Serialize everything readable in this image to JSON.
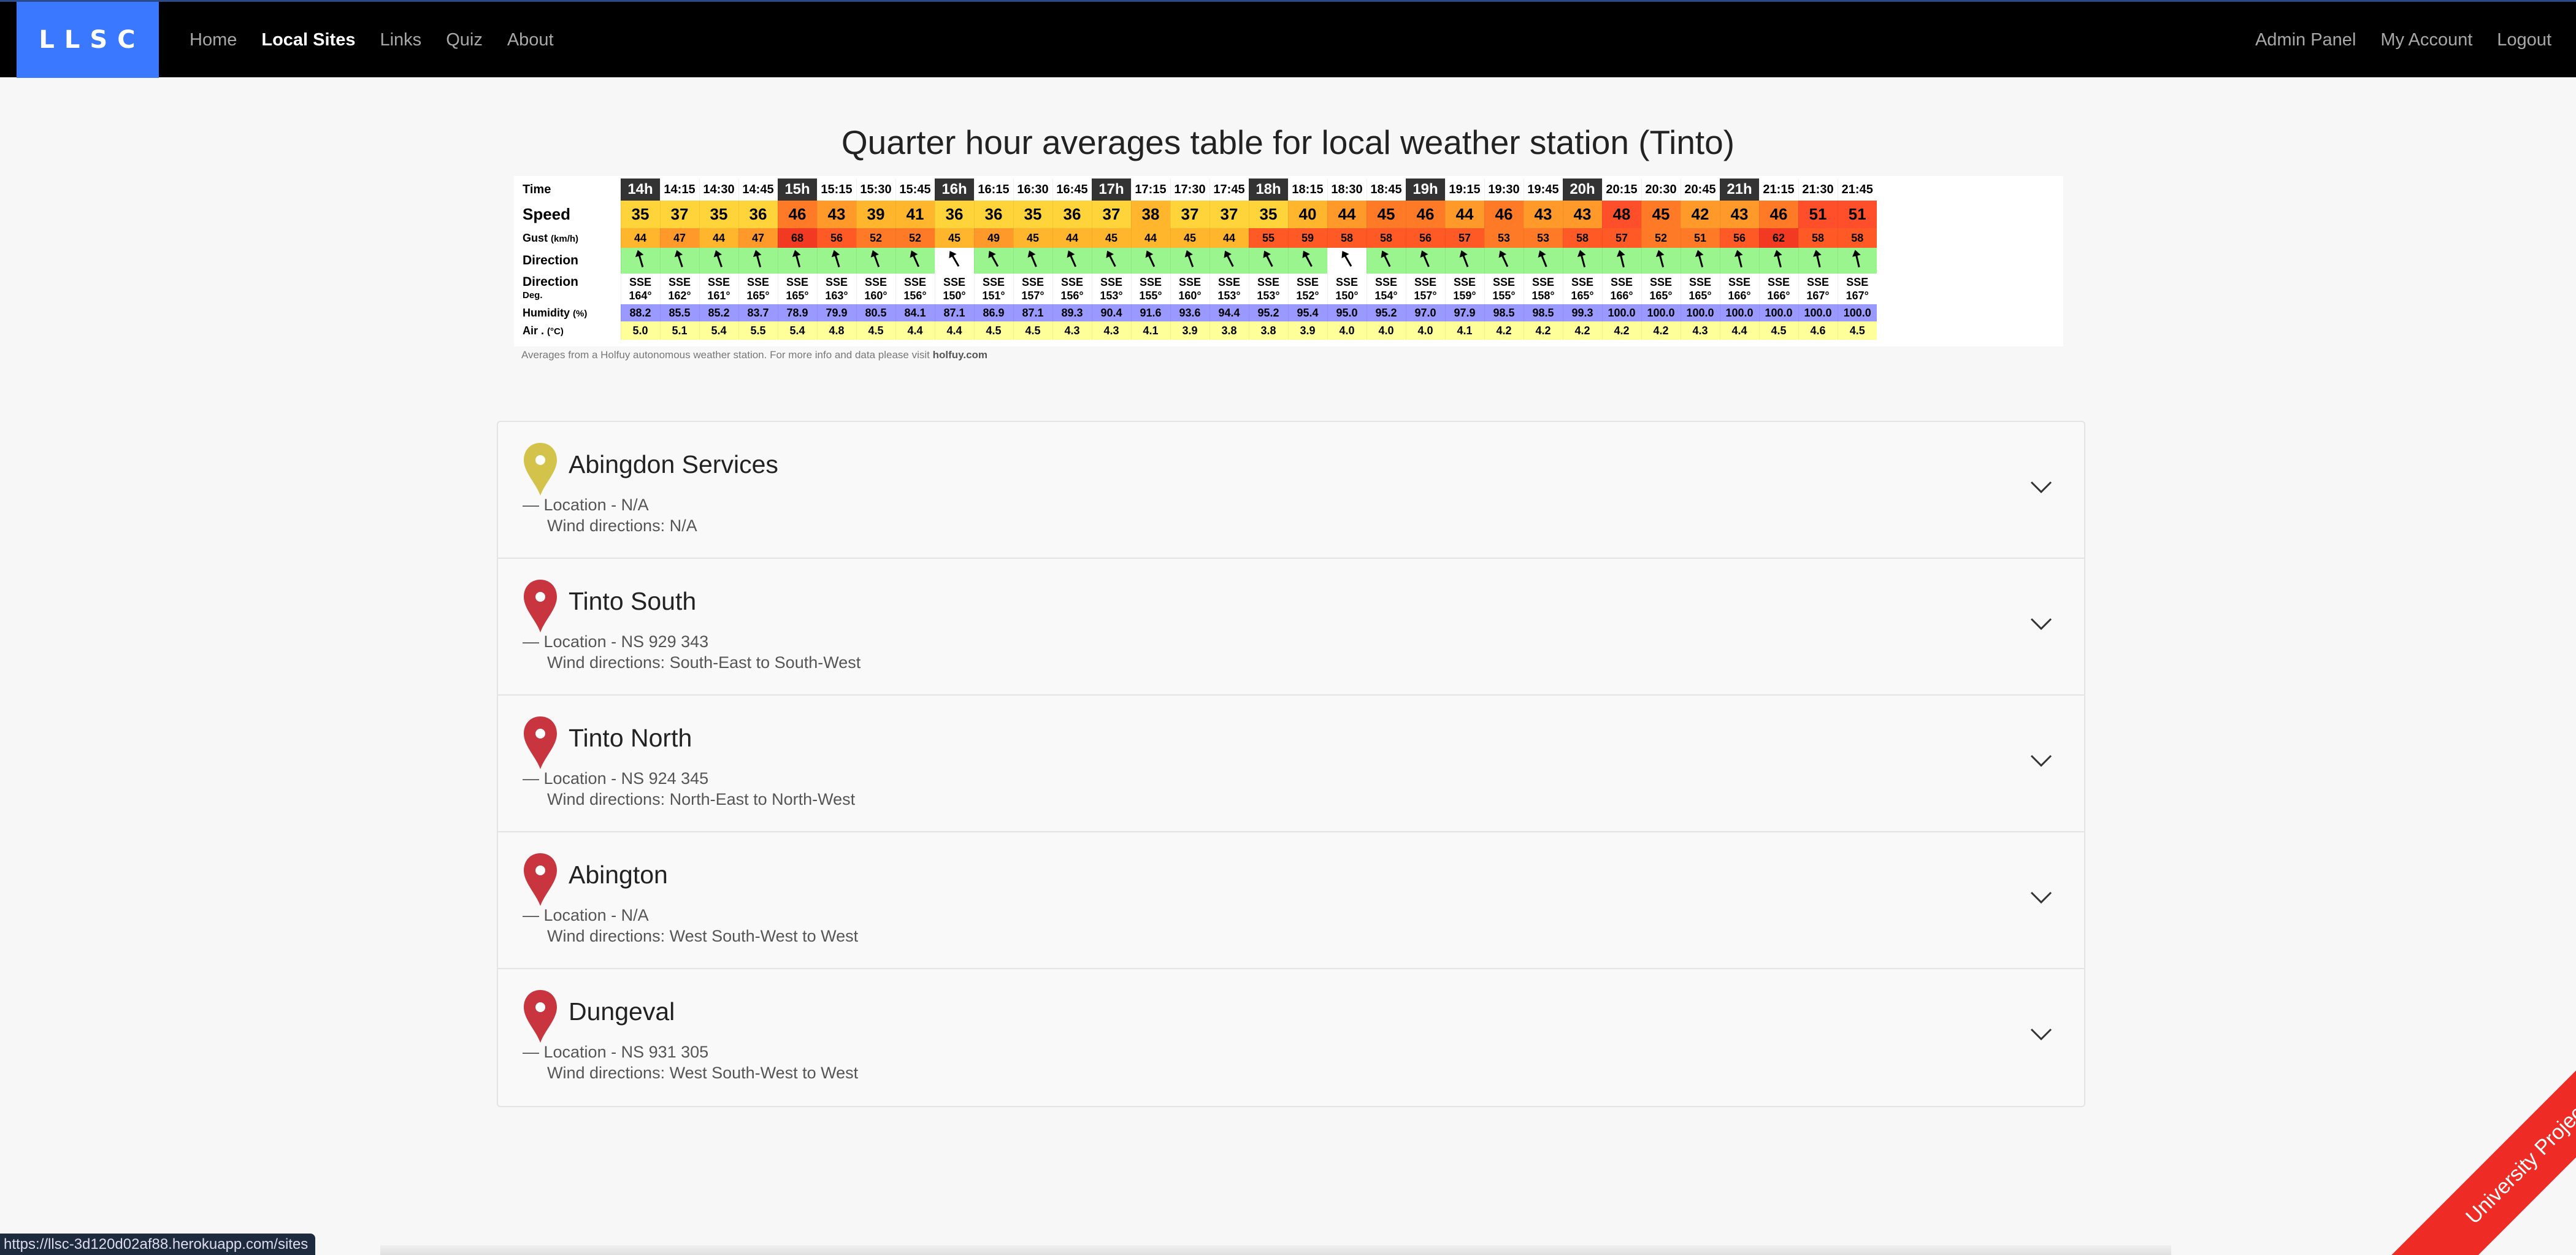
{
  "nav": {
    "brand": "LLSC",
    "left": [
      "Home",
      "Local Sites",
      "Links",
      "Quiz",
      "About"
    ],
    "right": [
      "Admin Panel",
      "My Account",
      "Logout"
    ],
    "active": "Local Sites"
  },
  "title": "Quarter hour averages table for local weather station (Tinto)",
  "weather": {
    "labels": {
      "time": "Time",
      "speed": "Speed",
      "gust": "Gust",
      "gust_unit": "(km/h)",
      "direction": "Direction",
      "direction_deg_1": "Direction",
      "direction_deg_2": "Deg.",
      "humidity": "Humidity",
      "humidity_unit": "(%)",
      "air": "Air .",
      "air_unit": "(°C)"
    },
    "times": [
      "14h",
      "14:15",
      "14:30",
      "14:45",
      "15h",
      "15:15",
      "15:30",
      "15:45",
      "16h",
      "16:15",
      "16:30",
      "16:45",
      "17h",
      "17:15",
      "17:30",
      "17:45",
      "18h",
      "18:15",
      "18:30",
      "18:45",
      "19h",
      "19:15",
      "19:30",
      "19:45",
      "20h",
      "20:15",
      "20:30",
      "20:45",
      "21h",
      "21:15",
      "21:30",
      "21:45"
    ],
    "speed": [
      "35",
      "37",
      "35",
      "36",
      "46",
      "43",
      "39",
      "41",
      "36",
      "36",
      "35",
      "36",
      "37",
      "38",
      "37",
      "37",
      "35",
      "40",
      "44",
      "45",
      "46",
      "44",
      "46",
      "43",
      "43",
      "48",
      "45",
      "42",
      "43",
      "46",
      "51",
      "51"
    ],
    "gust": [
      "44",
      "47",
      "44",
      "47",
      "68",
      "56",
      "52",
      "52",
      "45",
      "49",
      "45",
      "44",
      "45",
      "44",
      "45",
      "44",
      "55",
      "59",
      "58",
      "58",
      "56",
      "57",
      "53",
      "53",
      "58",
      "57",
      "52",
      "51",
      "56",
      "62",
      "58",
      "58"
    ],
    "dir_name": [
      "SSE",
      "SSE",
      "SSE",
      "SSE",
      "SSE",
      "SSE",
      "SSE",
      "SSE",
      "SSE",
      "SSE",
      "SSE",
      "SSE",
      "SSE",
      "SSE",
      "SSE",
      "SSE",
      "SSE",
      "SSE",
      "SSE",
      "SSE",
      "SSE",
      "SSE",
      "SSE",
      "SSE",
      "SSE",
      "SSE",
      "SSE",
      "SSE",
      "SSE",
      "SSE",
      "SSE",
      "SSE"
    ],
    "dir_deg": [
      164,
      162,
      161,
      165,
      165,
      163,
      160,
      156,
      150,
      151,
      157,
      156,
      153,
      155,
      160,
      153,
      153,
      152,
      150,
      154,
      157,
      159,
      155,
      158,
      165,
      166,
      165,
      165,
      166,
      166,
      167,
      167
    ],
    "dir_deg_text": [
      "164°",
      "162°",
      "161°",
      "165°",
      "165°",
      "163°",
      "160°",
      "156°",
      "150°",
      "151°",
      "157°",
      "156°",
      "153°",
      "155°",
      "160°",
      "153°",
      "153°",
      "152°",
      "150°",
      "154°",
      "157°",
      "159°",
      "155°",
      "158°",
      "165°",
      "166°",
      "165°",
      "165°",
      "166°",
      "166°",
      "167°",
      "167°"
    ],
    "humidity": [
      "88.2",
      "85.5",
      "85.2",
      "83.7",
      "78.9",
      "79.9",
      "80.5",
      "84.1",
      "87.1",
      "86.9",
      "87.1",
      "89.3",
      "90.4",
      "91.6",
      "93.6",
      "94.4",
      "95.2",
      "95.4",
      "95.0",
      "95.2",
      "97.0",
      "97.9",
      "98.5",
      "98.5",
      "99.3",
      "100.0",
      "100.0",
      "100.0",
      "100.0",
      "100.0",
      "100.0",
      "100.0"
    ],
    "air": [
      "5.0",
      "5.1",
      "5.4",
      "5.5",
      "5.4",
      "4.8",
      "4.5",
      "4.4",
      "4.4",
      "4.5",
      "4.5",
      "4.3",
      "4.3",
      "4.1",
      "3.9",
      "3.8",
      "3.8",
      "3.9",
      "4.0",
      "4.0",
      "4.0",
      "4.1",
      "4.2",
      "4.2",
      "4.2",
      "4.2",
      "4.2",
      "4.3",
      "4.4",
      "4.5",
      "4.6",
      "4.5"
    ],
    "note_prefix": "Averages from a Holfuy autonomous weather station. For more info and data please visit ",
    "note_link": "holfuy.com"
  },
  "sites": [
    {
      "name": "Abingdon Services",
      "location": "— Location - N/A",
      "wind": "Wind directions: N/A",
      "pin_color": "#d4c34a"
    },
    {
      "name": "Tinto South",
      "location": "— Location - NS 929 343",
      "wind": "Wind directions: South-East to South-West",
      "pin_color": "#c9353f"
    },
    {
      "name": "Tinto North",
      "location": "— Location - NS 924 345",
      "wind": "Wind directions: North-East to North-West",
      "pin_color": "#c9353f"
    },
    {
      "name": "Abington",
      "location": "— Location - N/A",
      "wind": "Wind directions: West South-West to West",
      "pin_color": "#c9353f"
    },
    {
      "name": "Dungeval",
      "location": "— Location - NS 931 305",
      "wind": "Wind directions: West South-West to West",
      "pin_color": "#c9353f"
    }
  ],
  "status_url": "https://llsc-3d120d02af88.herokuapp.com/sites",
  "ribbon": "University Project"
}
